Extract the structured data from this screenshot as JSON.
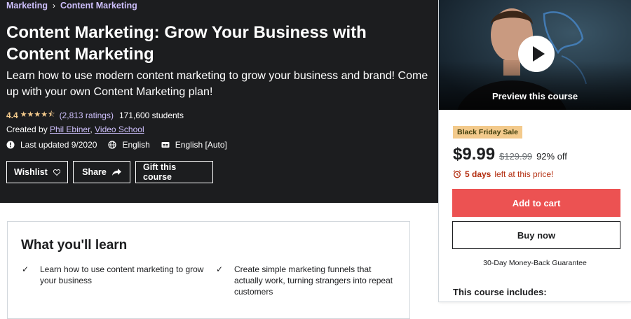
{
  "breadcrumb": {
    "items": [
      "Marketing",
      "Content Marketing"
    ],
    "separator": "›"
  },
  "course": {
    "title": "Content Marketing: Grow Your Business with Content Marketing",
    "subtitle": "Learn how to use modern content marketing to grow your business and brand! Come up with your own Content Marketing plan!",
    "rating": "4.4",
    "stars": "★★★★⯪",
    "ratings_count": "(2,813 ratings)",
    "students": "171,600 students",
    "created_by_label": "Created by",
    "creators": [
      "Phil Ebiner",
      "Video School"
    ],
    "creators_sep": ",",
    "last_updated": "Last updated 9/2020",
    "language": "English",
    "captions": "English [Auto]"
  },
  "actions": {
    "wishlist": "Wishlist",
    "share": "Share",
    "gift": "Gift this course"
  },
  "sidebar": {
    "preview_label": "Preview this course",
    "badge": "Black Friday Sale",
    "price": "$9.99",
    "original_price": "$129.99",
    "discount": "92% off",
    "timer_bold": "5 days",
    "timer_rest": "left at this price!",
    "add_to_cart": "Add to cart",
    "buy_now": "Buy now",
    "guarantee": "30-Day Money-Back Guarantee",
    "includes_title": "This course includes:"
  },
  "learn": {
    "heading": "What you'll learn",
    "items": [
      "Learn how to use content marketing to grow your business",
      "Create simple marketing funnels that actually work, turning strangers into repeat customers"
    ]
  },
  "colors": {
    "hero_bg": "#1c1d1f",
    "accent_purple": "#cec0fc",
    "star": "#f3ca8c",
    "cart": "#ec5252",
    "badge": "#f3ca8c",
    "timer": "#b32d0f"
  }
}
